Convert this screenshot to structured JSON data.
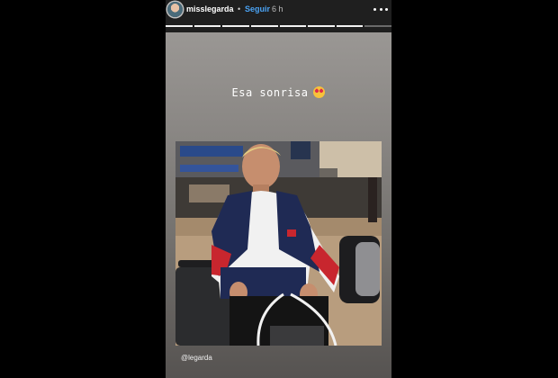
{
  "header": {
    "username": "misslegarda",
    "separator": "•",
    "follow_label": "Seguir",
    "time": "6 h",
    "more_icon": "more-dots-icon"
  },
  "progress": {
    "segments": 8,
    "completed": 7
  },
  "story": {
    "caption": "Esa sonrisa",
    "caption_emoji": "heart-eyes-emoji",
    "mention": "@legarda"
  },
  "colors": {
    "follow": "#4aa3f4",
    "background": "#000000"
  }
}
